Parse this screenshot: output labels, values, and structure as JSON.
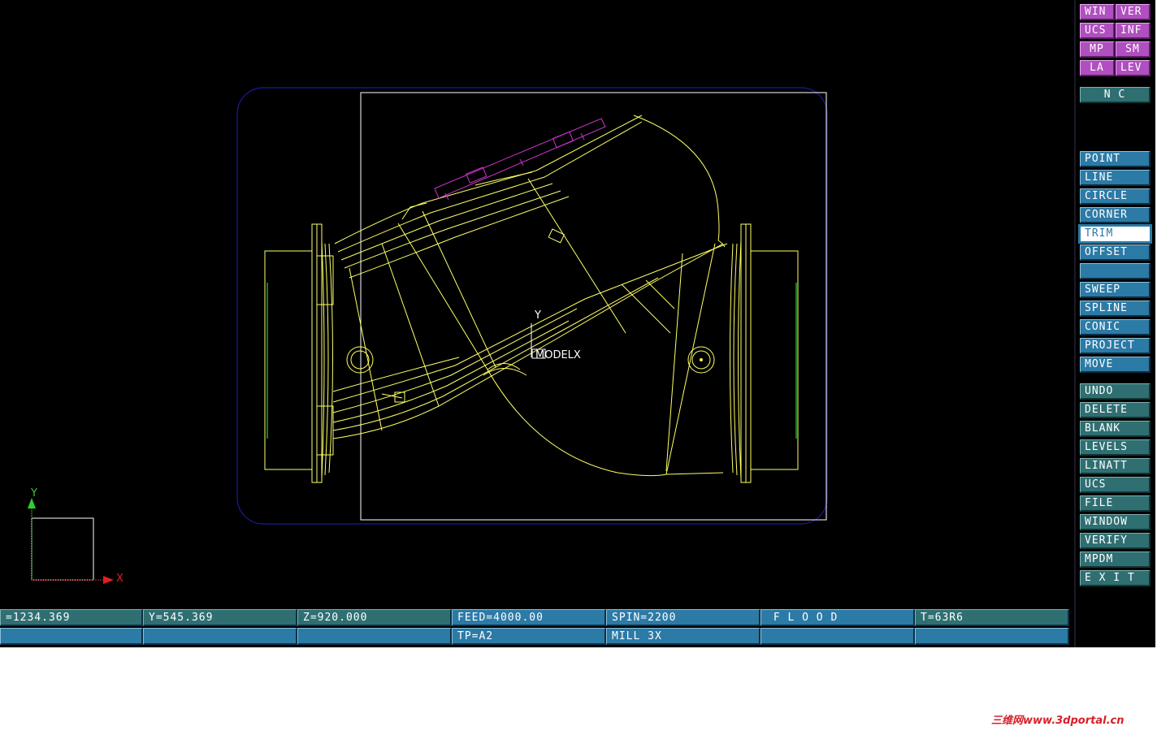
{
  "colors": {
    "viewport_bg": "#000000",
    "stock_outline": "#1a1aa0",
    "geometry": "#ffff66",
    "green_edge": "#33cc33",
    "magenta_geom": "#cc33cc",
    "button_blue": "#2c7aa6",
    "button_teal": "#2f6f72",
    "button_magenta": "#b04fbf",
    "axis_y": "#33cc33",
    "axis_x": "#e02020"
  },
  "viewport": {
    "model_label": "MODELX",
    "model_y_label": "Y",
    "triad_y": "Y",
    "triad_x": "X"
  },
  "top_buttons": [
    {
      "label": "WIN"
    },
    {
      "label": "VER"
    },
    {
      "label": "UCS"
    },
    {
      "label": "INF"
    },
    {
      "label": "MP"
    },
    {
      "label": "SM"
    },
    {
      "label": "LA"
    },
    {
      "label": "LEV"
    }
  ],
  "nc_button": {
    "label": "N C"
  },
  "create_menu": [
    {
      "label": "POINT"
    },
    {
      "label": "LINE"
    },
    {
      "label": "CIRCLE"
    },
    {
      "label": "CORNER"
    },
    {
      "label": "TRIM"
    },
    {
      "label": "OFFSET"
    },
    {
      "label": ""
    },
    {
      "label": "SWEEP"
    },
    {
      "label": "SPLINE"
    },
    {
      "label": "CONIC"
    },
    {
      "label": "PROJECT"
    },
    {
      "label": "MOVE"
    }
  ],
  "utility_menu": [
    {
      "label": "UNDO"
    },
    {
      "label": "DELETE"
    },
    {
      "label": "BLANK"
    },
    {
      "label": "LEVELS"
    },
    {
      "label": "LINATT"
    },
    {
      "label": "UCS"
    },
    {
      "label": "FILE"
    },
    {
      "label": "WINDOW"
    },
    {
      "label": "VERIFY"
    },
    {
      "label": "MPDM"
    },
    {
      "label": "E X I T"
    }
  ],
  "status_row1": [
    {
      "label": "=1234.369"
    },
    {
      "label": "Y=545.369"
    },
    {
      "label": "Z=920.000"
    },
    {
      "label": "FEED=4000.00"
    },
    {
      "label": "SPIN=2200"
    },
    {
      "label": " F L O O D"
    },
    {
      "label": "T=63R6"
    }
  ],
  "status_row2": [
    {
      "label": ""
    },
    {
      "label": ""
    },
    {
      "label": ""
    },
    {
      "label": "TP=A2"
    },
    {
      "label": "MILL 3X"
    },
    {
      "label": ""
    },
    {
      "label": ""
    }
  ],
  "watermark": "三维网www.3dportal.cn"
}
